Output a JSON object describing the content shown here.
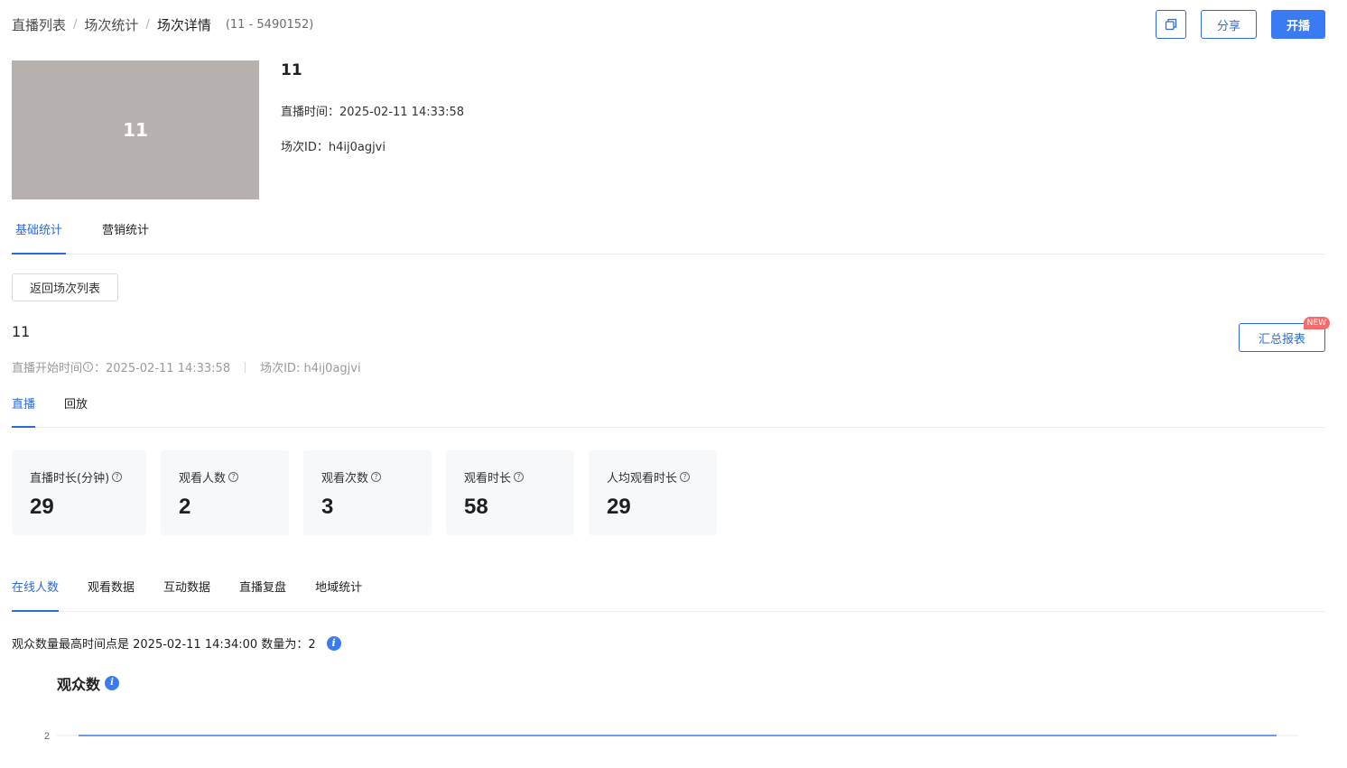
{
  "breadcrumb": {
    "items": [
      "直播列表",
      "场次统计",
      "场次详情"
    ],
    "sub": "(11 - 5490152)"
  },
  "header_buttons": {
    "copy_icon": "copy-icon",
    "share_label": "分享",
    "start_label": "开播"
  },
  "live_info": {
    "cover_text": "11",
    "title": "11",
    "live_time": "直播时间：2025-02-11 14:33:58",
    "session_id": "场次ID：h4ij0agjvi"
  },
  "main_tabs": [
    {
      "label": "基础统计",
      "active": true
    },
    {
      "label": "营销统计",
      "active": false
    }
  ],
  "back_button_label": "返回场次列表",
  "session": {
    "title": "11",
    "start_time_label": "直播开始时间",
    "start_time_value": "：2025-02-11 14:33:58",
    "session_id": "场次ID: h4ij0agjvi"
  },
  "report_button": {
    "label": "汇总报表",
    "badge": "NEW"
  },
  "sub_tabs": [
    {
      "label": "直播",
      "active": true
    },
    {
      "label": "回放",
      "active": false
    }
  ],
  "stats": [
    {
      "label": "直播时长(分钟)",
      "value": "29"
    },
    {
      "label": "观看人数",
      "value": "2"
    },
    {
      "label": "观看次数",
      "value": "3"
    },
    {
      "label": "观看时长",
      "value": "58"
    },
    {
      "label": "人均观看时长",
      "value": "29"
    }
  ],
  "chart_tabs": [
    {
      "label": "在线人数",
      "active": true
    },
    {
      "label": "观看数据",
      "active": false
    },
    {
      "label": "互动数据",
      "active": false
    },
    {
      "label": "直播复盘",
      "active": false
    },
    {
      "label": "地域统计",
      "active": false
    }
  ],
  "peak_text": "观众数量最高时间点是 2025-02-11 14:34:00 数量为：2",
  "chart_data": {
    "type": "line",
    "title": "观众数",
    "y_ticks": [
      2
    ],
    "series": [
      {
        "values": [
          2,
          2
        ]
      }
    ],
    "colors": {
      "line": "#3a7af2",
      "grid": "#e8e8e8"
    }
  },
  "colors": {
    "accent": "#2f6bd8",
    "primary_button": "#3a7af2",
    "badge": "#f56c6c",
    "card_bg": "#f7f8fa",
    "cover_bg": "#b6b1ad"
  }
}
